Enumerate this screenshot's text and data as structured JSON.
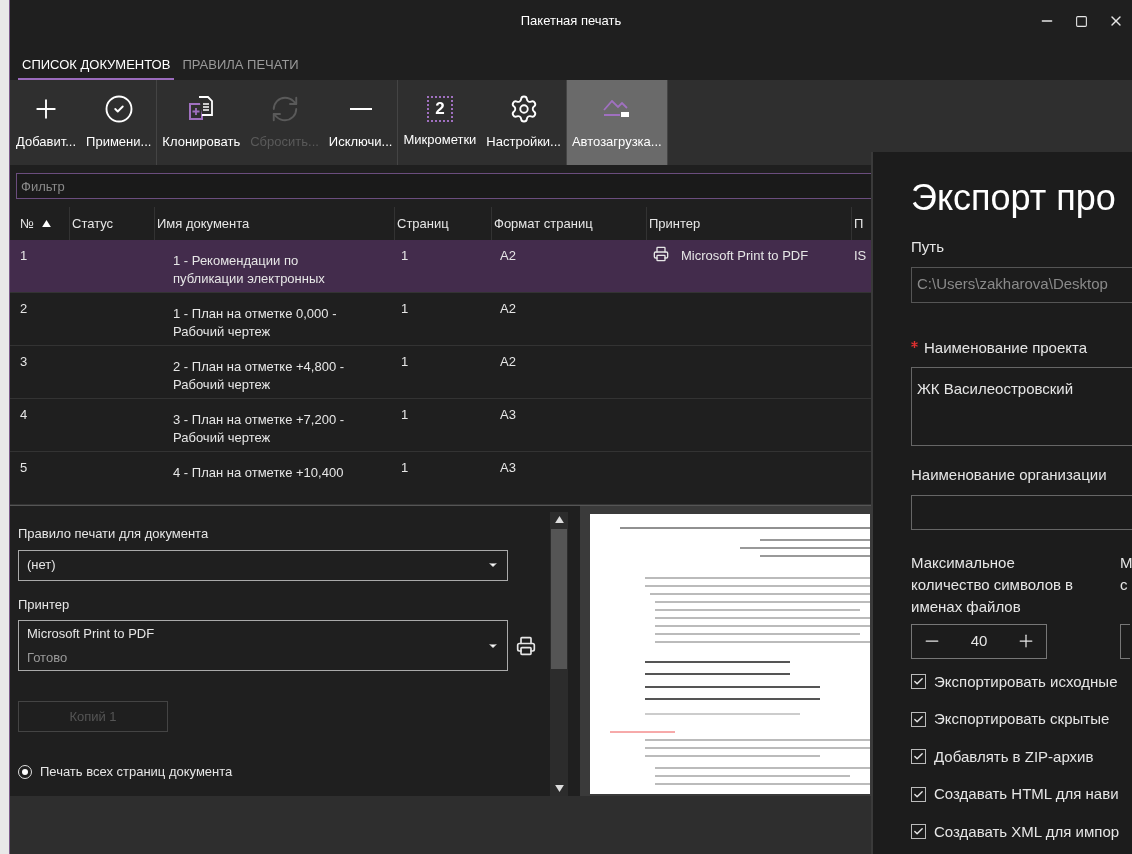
{
  "window": {
    "title": "Пакетная печать"
  },
  "tabs": [
    {
      "label": "СПИСОК ДОКУМЕНТОВ",
      "selected": true
    },
    {
      "label": "ПРАВИЛА ПЕЧАТИ",
      "selected": false
    }
  ],
  "toolbar": {
    "groups": [
      {
        "buttons": [
          {
            "kind": "add",
            "label": "Добавит...",
            "disabled": false,
            "selected": false
          },
          {
            "kind": "apply",
            "label": "Примени...",
            "disabled": false,
            "selected": false
          }
        ]
      },
      {
        "buttons": [
          {
            "kind": "clone",
            "label": "Клонировать",
            "disabled": false,
            "selected": false
          },
          {
            "kind": "reset",
            "label": "Сбросить...",
            "disabled": true,
            "selected": false
          },
          {
            "kind": "exclude",
            "label": "Исключи...",
            "disabled": false,
            "selected": false
          }
        ]
      },
      {
        "buttons": [
          {
            "kind": "marks",
            "label": "Микрометки",
            "icon_text": "2",
            "disabled": false,
            "selected": false
          },
          {
            "kind": "settings",
            "label": "Настройки...",
            "disabled": false,
            "selected": false
          }
        ]
      },
      {
        "buttons": [
          {
            "kind": "autoload",
            "label": "Автозагрузка...",
            "disabled": false,
            "selected": true
          }
        ]
      }
    ]
  },
  "filter": {
    "placeholder": "Фильтр"
  },
  "table": {
    "columns": [
      {
        "label": "№",
        "sorted": true
      },
      {
        "label": "Статус",
        "sorted": false
      },
      {
        "label": "Имя документа",
        "sorted": false
      },
      {
        "label": "Страниц",
        "sorted": false
      },
      {
        "label": "Формат страниц",
        "sorted": false
      },
      {
        "label": "Принтер",
        "sorted": false
      },
      {
        "label": "П",
        "sorted": false
      }
    ],
    "rows": [
      {
        "number": "1",
        "name": "1 - Рекомендации по публикации электронных",
        "pages": "1",
        "format": "A2",
        "printer": "Microsoft Print to PDF",
        "column_7": "IS",
        "selected": true
      },
      {
        "number": "2",
        "name": "1 - План на отметке 0,000 - Рабочий чертеж",
        "pages": "1",
        "format": "A2",
        "selected": false
      },
      {
        "number": "3",
        "name": "2 - План на отметке +4,800 - Рабочий чертеж",
        "pages": "1",
        "format": "A2",
        "selected": false
      },
      {
        "number": "4",
        "name": "3 - План на отметке +7,200 - Рабочий чертеж",
        "pages": "1",
        "format": "A3",
        "selected": false
      },
      {
        "number": "5",
        "name": "4 - План на отметке +10,400",
        "pages": "1",
        "format": "A3",
        "selected": false
      }
    ]
  },
  "print_settings": {
    "rule": {
      "label": "Правило печати для документа",
      "value": "(нет)"
    },
    "printer": {
      "label": "Принтер",
      "value": "Microsoft Print to PDF",
      "status": "Готово"
    },
    "copies": {
      "label": "Копий 1",
      "disabled": true
    },
    "print_modes": [
      {
        "label": "Печать всех страниц документа",
        "selected": true
      }
    ]
  },
  "export_panel": {
    "title": "Экспорт про",
    "path": {
      "label": "Путь",
      "value": "C:\\Users\\zakharova\\Desktop",
      "disabled": true
    },
    "project_name": {
      "label": "Наименование проекта",
      "required": true,
      "value": "ЖК Василеостровский"
    },
    "organization": {
      "label": "Наименование организации"
    },
    "max_chars": {
      "label": "Максимальное количество символов в именах файлов",
      "value": "40"
    },
    "column_2_label": "М с",
    "options": [
      {
        "label": "Экспортировать исходные",
        "checked": true
      },
      {
        "label": "Экспортировать скрытые",
        "checked": true
      },
      {
        "label": "Добавлять в ZIP-архив",
        "checked": true
      },
      {
        "label": "Создавать HTML для нави",
        "checked": true
      },
      {
        "label": "Создавать XML для импор",
        "checked": true
      }
    ]
  }
}
